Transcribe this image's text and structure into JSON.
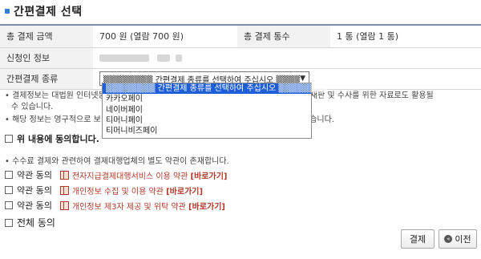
{
  "header": {
    "title": "간편결제 선택"
  },
  "info_table": {
    "total_amount_label": "총 결제 금액",
    "total_amount_value": "700 원 (열람 700 원)",
    "total_count_label": "총 결제 통수",
    "total_count_value": "1 통 (열람 1 통)",
    "applicant_label": "신청인 정보",
    "payment_type_label": "간편결제 종류",
    "payment_type_selected": "▒▒▒▒▒▒▒▒ 간편결제 종류를 선택하여 주십시오 ▒▒▒▒▒▒▒▒"
  },
  "dropdown": {
    "options": [
      "▒▒▒▒▒▒▒▒ 간편결제 종류를 선택하여 주십시오 ▒▒▒▒▒▒▒▒",
      "카카오페이",
      "네이버페이",
      "티머니페이",
      "티머니비즈페이"
    ]
  },
  "notes": {
    "line1_left": "• 결제정보는 대법원 인터넷등",
    "line1_right": "이용되며 재판 및 수사를 위한 자료로도 활용될",
    "line2": "수 있습니다.",
    "line3_left": "• 해당 정보는 영구적으로 보",
    "line3_right": "이용할 수 없습니다.",
    "agree_all_label": "위 내용에 동의합니다.",
    "fee_note": "• 수수료 결제와 관련하여 결제대행업체의 별도 약관이 존재합니다."
  },
  "terms": [
    {
      "agree_label": "약관 동의",
      "text": "전자지급결제대행서비스 이용 약관",
      "link": "[바로가기]"
    },
    {
      "agree_label": "약관 동의",
      "text": "개인정보 수집 및 이용 약관",
      "link": "[바로가기]"
    },
    {
      "agree_label": "약관 동의",
      "text": "개인정보 제3자 제공 및 위탁 약관",
      "link": "[바로가기]"
    }
  ],
  "all_agree_label": "전체 동의",
  "buttons": {
    "pay": "결제",
    "prev": "이전",
    "prev_icon": "«"
  },
  "colors": {
    "accent": "#2f7fd8",
    "link": "#b0392b",
    "selected_option": "#1e5ed8"
  }
}
